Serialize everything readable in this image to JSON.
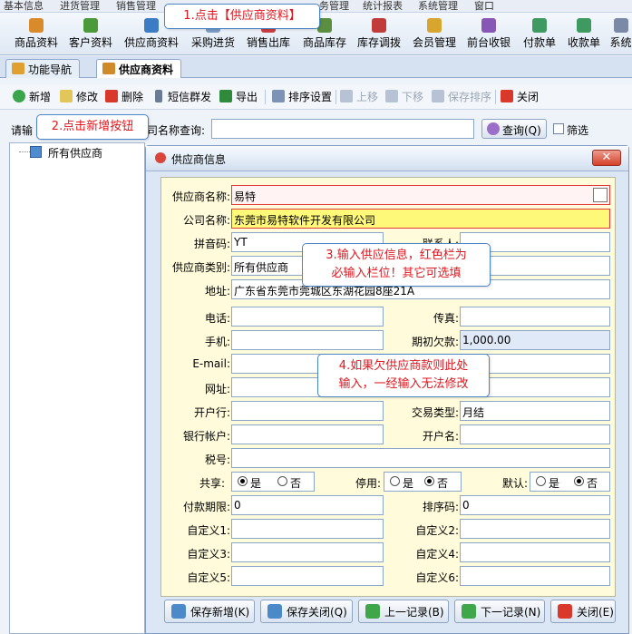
{
  "menubar": [
    "基本信息",
    "进货管理",
    "销售管理",
    "务管理",
    "统计报表",
    "系统管理",
    "窗口"
  ],
  "toolbar": [
    {
      "label": "商品资料",
      "icon": "goods-icon",
      "color": "#d98a2b"
    },
    {
      "label": "客户资料",
      "icon": "customers-icon",
      "color": "#4b9a3a"
    },
    {
      "label": "供应商资料",
      "icon": "supplier-icon",
      "color": "#3c7cc4"
    },
    {
      "label": "采购进货",
      "icon": "purchase-icon",
      "color": "#7a9cc6"
    },
    {
      "label": "销售出库",
      "icon": "sales-icon",
      "color": "#c94040"
    },
    {
      "label": "商品库存",
      "icon": "stock-icon",
      "color": "#5b8f3f"
    },
    {
      "label": "库存调拨",
      "icon": "transfer-icon",
      "color": "#c23b3b"
    },
    {
      "label": "会员管理",
      "icon": "member-icon",
      "color": "#d8a62e"
    },
    {
      "label": "前台收银",
      "icon": "cashier-icon",
      "color": "#8857b5"
    },
    {
      "label": "付款单",
      "icon": "payment-icon",
      "color": "#3f9a62"
    },
    {
      "label": "收款单",
      "icon": "receipt-icon",
      "color": "#3f9a62"
    },
    {
      "label": "系统",
      "icon": "system-icon",
      "color": "#7a8aa6"
    }
  ],
  "tabs": [
    {
      "label": "功能导航",
      "icon": "chart-icon",
      "color": "#e0a030"
    },
    {
      "label": "供应商资料",
      "icon": "supplier-icon",
      "color": "#d08a2a"
    }
  ],
  "actions": {
    "add": "新增",
    "edit": "修改",
    "delete": "删除",
    "sms": "短信群发",
    "export": "导出",
    "sort_settings": "排序设置",
    "move_up": "上移",
    "move_down": "下移",
    "save_sort": "保存排序",
    "close": "关闭"
  },
  "search": {
    "label_left": "请输",
    "label_right": "司名称查询:",
    "value": "",
    "query_button": "查询(Q)",
    "filter_label": "筛选"
  },
  "tree": {
    "root": "所有供应商"
  },
  "dialog": {
    "title": "供应商信息",
    "fields": {
      "supplier_name_label": "供应商名称:",
      "supplier_name": "易特",
      "company_name_label": "公司名称:",
      "company_name": "东莞市易特软件开发有限公司",
      "pinyin_label": "拼音码:",
      "pinyin": "YT",
      "contact_label": "联系人:",
      "contact": "",
      "category_label": "供应商类别:",
      "category": "所有供应商",
      "address_label": "地址:",
      "address": "广东省东莞市莞城区东湖花园8座21A",
      "phone_label": "电话:",
      "phone": "",
      "fax_label": "传真:",
      "fax": "",
      "mobile_label": "手机:",
      "mobile": "",
      "initial_debt_label": "期初欠款:",
      "initial_debt": "1,000.00",
      "email_label": "E-mail:",
      "email": "",
      "website_label": "网址:",
      "website": "",
      "bank_label": "开户行:",
      "bank": "",
      "trade_type_label": "交易类型:",
      "trade_type": "月结",
      "account_label": "银行帐户:",
      "account": "",
      "account_name_label": "开户名:",
      "account_name": "",
      "tax_label": "税号:",
      "tax": "",
      "share_label": "共享:",
      "disable_label": "停用:",
      "default_label": "默认:",
      "yes": "是",
      "no": "否",
      "pay_term_label": "付款期限:",
      "pay_term": "0",
      "sort_code_label": "排序码:",
      "sort_code": "0",
      "custom1_label": "自定义1:",
      "custom2_label": "自定义2:",
      "custom3_label": "自定义3:",
      "custom4_label": "自定义4:",
      "custom5_label": "自定义5:",
      "custom6_label": "自定义6:"
    },
    "radios": {
      "share": "yes",
      "disable": "no",
      "default": "no"
    },
    "buttons": {
      "save_new": "保存新增(K)",
      "save_close": "保存关闭(Q)",
      "prev": "上一记录(B)",
      "next": "下一记录(N)",
      "close": "关闭(E)"
    }
  },
  "callouts": {
    "step1": "1.点击【供应商资料】",
    "step2": "2.点击新增按钮",
    "step3_line1": "3.输入供应信息，红色栏为",
    "step3_line2": "必输入栏位！其它可选填",
    "step4_line1": "4.如果欠供应商款则此处",
    "step4_line2": "输入，一经输入无法修改"
  }
}
